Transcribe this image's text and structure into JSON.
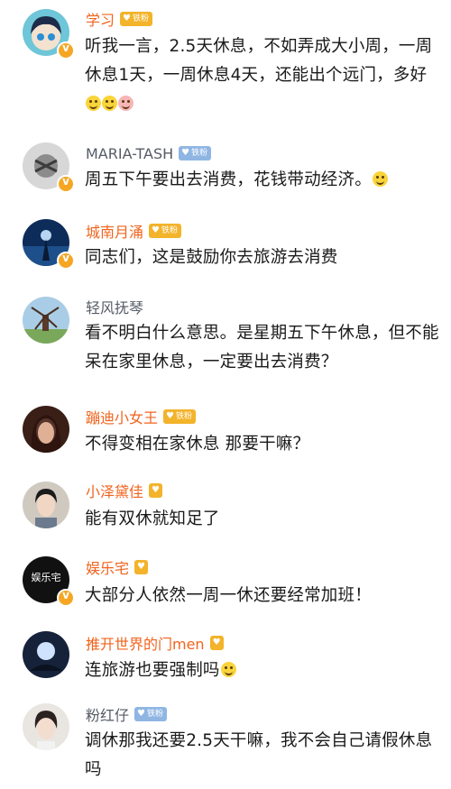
{
  "comments": [
    {
      "name": "学习",
      "badge": "铁粉",
      "text": "听我一言，2.5天休息，不如弄成大小周，一周休息1天，一周休息4天，还能出个远门，多好",
      "emojis": [
        "doge-emoji",
        "doge-emoji",
        "pig-emoji"
      ]
    },
    {
      "name": "MARIA-TASH",
      "badge": "铁粉",
      "text": "周五下午要出去消费，花钱带动经济。",
      "emojis": [
        "grin-emoji"
      ]
    },
    {
      "name": "城南月涌",
      "badge": "铁粉",
      "text": "同志们，这是鼓励你去旅游去消费"
    },
    {
      "name": "轻风抚琴",
      "text": "看不明白什么意思。是星期五下午休息，但不能呆在家里休息，一定要出去消费？"
    },
    {
      "name": "蹦迪小女王",
      "badge": "铁粉",
      "text": "不得变相在家休息 那要干嘛？"
    },
    {
      "name": "小泽黛佳",
      "text": "能有双休就知足了"
    },
    {
      "name": "娱乐宅",
      "avatar_text": "娱乐宅",
      "text": "大部分人依然一周一休还要经常加班！"
    },
    {
      "name": "推开世界的门men",
      "text": "连旅游也要强制吗",
      "emojis": [
        "sweat-smile-emoji"
      ]
    },
    {
      "name": "粉红仔",
      "badge": "铁粉",
      "text": "调休那我还要2.5天干嘛，我不会自己请假休息吗"
    }
  ],
  "colors": {
    "vip_name": "#f0641e",
    "normal_name": "#555b66",
    "text": "#1a1a1a",
    "fan_badge_gold": "#f3b32a",
    "fan_badge_blue": "#8fb6e3"
  }
}
